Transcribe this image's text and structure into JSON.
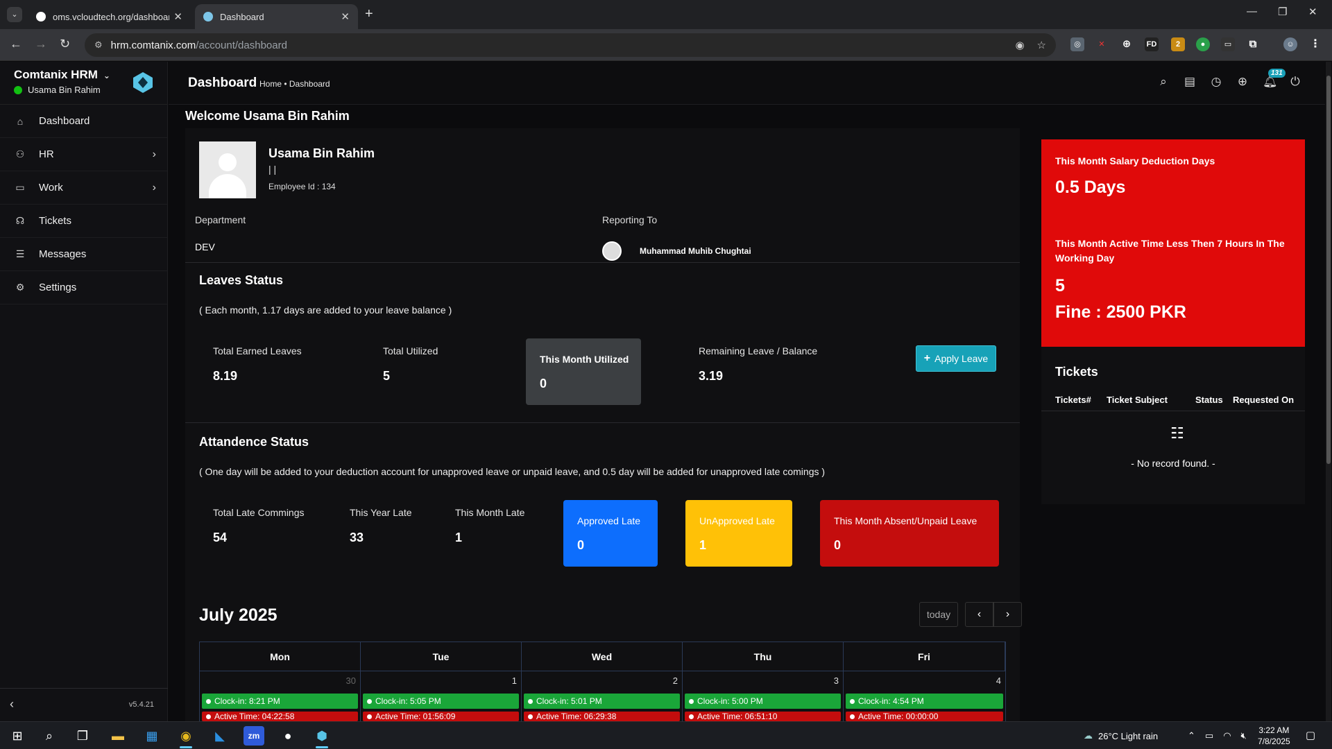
{
  "browser": {
    "tabs": [
      {
        "label": "oms.vcloudtech.org/dashboard"
      },
      {
        "label": "Dashboard"
      }
    ],
    "url_host": "hrm.comtanix.com",
    "url_path": "/account/dashboard"
  },
  "sidebar": {
    "app_name": "Comtanix HRM",
    "user_name": "Usama Bin Rahim",
    "items": [
      {
        "label": "Dashboard",
        "icon": "home-icon"
      },
      {
        "label": "HR",
        "icon": "users-icon"
      },
      {
        "label": "Work",
        "icon": "briefcase-icon"
      },
      {
        "label": "Tickets",
        "icon": "headset-icon"
      },
      {
        "label": "Messages",
        "icon": "message-icon"
      },
      {
        "label": "Settings",
        "icon": "gear-icon"
      }
    ],
    "version": "v5.4.21"
  },
  "topbar": {
    "title": "Dashboard",
    "breadcrumb": "Home • Dashboard",
    "notification_count": "131"
  },
  "welcome": "Welcome Usama Bin Rahim",
  "profile": {
    "name": "Usama Bin Rahim",
    "bars": "| |",
    "employee_id": "Employee Id : 134",
    "department_label": "Department",
    "department_value": "DEV",
    "reporting_label": "Reporting To",
    "reporting_value": "Muhammad Muhib Chughtai"
  },
  "leaves": {
    "title": "Leaves Status",
    "note": "( Each month, 1.17 days are added to your leave balance )",
    "total_earned_label": "Total Earned Leaves",
    "total_earned_value": "8.19",
    "total_utilized_label": "Total Utilized",
    "total_utilized_value": "5",
    "month_utilized_label": "This Month Utilized",
    "month_utilized_value": "0",
    "remaining_label": "Remaining Leave / Balance",
    "remaining_value": "3.19",
    "apply_button": "Apply Leave"
  },
  "attendance": {
    "title": "Attandence Status",
    "note": "( One day will be added to your deduction account for unapproved leave or unpaid leave, and 0.5 day will be added for unapproved late comings )",
    "total_late_label": "Total Late Commings",
    "total_late_value": "54",
    "year_late_label": "This Year Late",
    "year_late_value": "33",
    "month_late_label": "This Month Late",
    "month_late_value": "1",
    "approved_label": "Approved Late",
    "approved_value": "0",
    "unapproved_label": "UnApproved Late",
    "unapproved_value": "1",
    "absent_label": "This Month Absent/Unpaid Leave",
    "absent_value": "0"
  },
  "calendar": {
    "title": "July 2025",
    "today_button": "today",
    "days": [
      {
        "name": "Mon",
        "date": "30",
        "clock_in": "Clock-in: 8:21 PM",
        "active": "Active Time: 04:22:58"
      },
      {
        "name": "Tue",
        "date": "1",
        "clock_in": "Clock-in: 5:05 PM",
        "active": "Active Time: 01:56:09"
      },
      {
        "name": "Wed",
        "date": "2",
        "clock_in": "Clock-in: 5:01 PM",
        "active": "Active Time: 06:29:38"
      },
      {
        "name": "Thu",
        "date": "3",
        "clock_in": "Clock-in: 5:00 PM",
        "active": "Active Time: 06:51:10"
      },
      {
        "name": "Fri",
        "date": "4",
        "clock_in": "Clock-in: 4:54 PM",
        "active": "Active Time: 00:00:00"
      }
    ]
  },
  "deductions": {
    "salary_label": "This Month Salary Deduction Days",
    "salary_value": "0.5 Days",
    "active_label": "This Month Active Time Less Then 7 Hours In The Working Day",
    "active_value": "5",
    "fine": "Fine : 2500 PKR"
  },
  "tickets": {
    "title": "Tickets",
    "columns": [
      "Tickets#",
      "Ticket Subject",
      "Status",
      "Requested On"
    ],
    "empty": "- No record found. -"
  },
  "taskbar": {
    "weather": "26°C  Light rain",
    "time": "3:22 AM",
    "date": "7/8/2025"
  },
  "colors": {
    "accent": "#17a2b8",
    "danger": "#e00a0a",
    "approved": "#0d6efd",
    "unapproved": "#ffc107",
    "absent": "#c40d0d",
    "online": "#12c012"
  }
}
